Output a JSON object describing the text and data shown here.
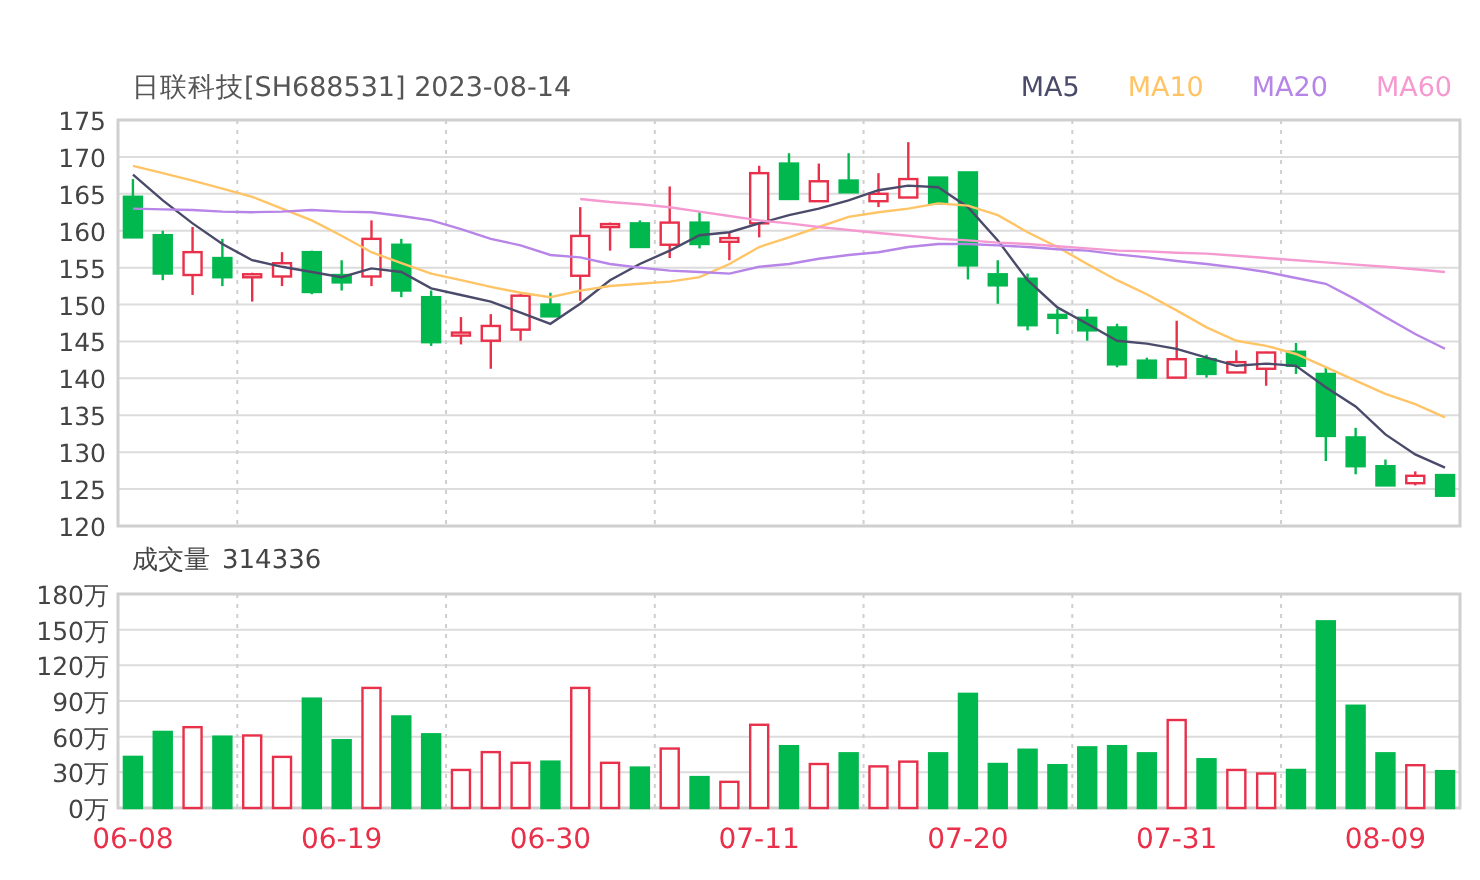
{
  "title": "日联科技[SH688531] 2023-08-14",
  "price_chart": {
    "chart_data": {
      "type": "candlestick",
      "grid": true,
      "ylim": [
        120,
        175
      ],
      "yticks": [
        120,
        125,
        130,
        135,
        140,
        145,
        150,
        155,
        160,
        165,
        170,
        175
      ],
      "categories": [
        null,
        null,
        null,
        null,
        null,
        null,
        null,
        null,
        null,
        null,
        null,
        null,
        null,
        null,
        null,
        null,
        null,
        null,
        null,
        null,
        null,
        null,
        null,
        null,
        null,
        null,
        null,
        null,
        null,
        null,
        null,
        null,
        null,
        null,
        null,
        null,
        null,
        null,
        null,
        null,
        null,
        null,
        null,
        null,
        null
      ],
      "ohlc": [
        [
          164.6,
          167,
          159,
          159.1
        ],
        [
          159.4,
          160,
          153.3,
          154.2
        ],
        [
          154,
          160.5,
          151.3,
          157.1
        ],
        [
          156.3,
          158.9,
          152.5,
          153.7
        ],
        [
          153.8,
          154.3,
          150.4,
          154.1
        ],
        [
          153.8,
          157.1,
          152.5,
          155.6
        ],
        [
          157.1,
          157.3,
          151.4,
          151.7
        ],
        [
          154,
          156,
          151.9,
          153
        ],
        [
          153.8,
          161.4,
          152.5,
          158.9
        ],
        [
          158.1,
          158.9,
          151,
          151.9
        ],
        [
          151,
          151.9,
          144.4,
          144.9
        ],
        [
          145.9,
          148.3,
          144.6,
          146.2
        ],
        [
          145.1,
          148.7,
          141.3,
          147.1
        ],
        [
          146.6,
          151.4,
          145.1,
          151.2
        ],
        [
          150,
          151.6,
          148.3,
          148.4
        ],
        [
          153.9,
          163.2,
          150.5,
          159.3
        ],
        [
          160.5,
          161.1,
          157.3,
          160.9
        ],
        [
          161,
          161.4,
          157.8,
          157.8
        ],
        [
          158.1,
          166,
          156.3,
          161.1
        ],
        [
          161.1,
          162.5,
          157.6,
          158.2
        ],
        [
          158.5,
          159.8,
          156,
          159
        ],
        [
          161,
          168.8,
          159.1,
          167.8
        ],
        [
          169.1,
          170.5,
          164.3,
          164.3
        ],
        [
          164,
          169.1,
          164,
          166.7
        ],
        [
          166.8,
          170.5,
          165.2,
          165.2
        ],
        [
          164,
          167.8,
          163.2,
          165
        ],
        [
          164.5,
          172,
          164.5,
          167
        ],
        [
          167.2,
          167.2,
          163.7,
          163.7
        ],
        [
          167.9,
          167.9,
          153.4,
          155.3
        ],
        [
          154.1,
          156,
          150.1,
          152.6
        ],
        [
          153.5,
          154.2,
          146.5,
          147.2
        ],
        [
          148.6,
          149.4,
          146,
          148.3
        ],
        [
          148.2,
          149.4,
          145.1,
          146.5
        ],
        [
          146.9,
          147.4,
          141.5,
          141.9
        ],
        [
          142.4,
          142.8,
          140.1,
          140.1
        ],
        [
          140.1,
          147.8,
          140.1,
          142.6
        ],
        [
          142.6,
          143.2,
          140.1,
          140.6
        ],
        [
          140.8,
          143.8,
          140.8,
          142.2
        ],
        [
          141.3,
          143.6,
          139,
          143.5
        ],
        [
          143.6,
          144.8,
          140.6,
          141.7
        ],
        [
          140.6,
          141.5,
          128.8,
          132.2
        ],
        [
          132,
          133.3,
          127,
          128.1
        ],
        [
          128.1,
          129,
          125.5,
          125.5
        ],
        [
          125.8,
          127.4,
          125.5,
          126.8
        ],
        [
          126.9,
          126.9,
          124.1,
          124.1
        ]
      ],
      "series": [
        {
          "name": "MA5",
          "type": "line",
          "color": "#4a4a6a",
          "values": [
            167.6,
            164.1,
            161,
            158.2,
            156,
            155.1,
            154.4,
            153.7,
            154.9,
            154.4,
            152.2,
            151.3,
            150.4,
            148.9,
            147.4,
            150.1,
            153.3,
            155.5,
            157.3,
            159.4,
            159.8,
            161,
            162.1,
            163,
            164.1,
            165.5,
            166.1,
            165.9,
            163.2,
            158.7,
            153.3,
            149.6,
            147.4,
            145.1,
            144.7,
            144,
            142.8,
            141.7,
            142,
            141.7,
            138.8,
            136.2,
            132.4,
            129.7,
            127.9
          ]
        },
        {
          "name": "MA10",
          "type": "line",
          "color": "#ffc466",
          "values": [
            168.8,
            167.8,
            166.8,
            165.7,
            164.6,
            163,
            161.4,
            159.3,
            157.1,
            155.6,
            154.2,
            153.3,
            152.4,
            151.6,
            151,
            151.9,
            152.5,
            152.8,
            153.1,
            153.7,
            155.5,
            157.8,
            159.1,
            160.5,
            161.9,
            162.5,
            163,
            163.7,
            163.4,
            162.1,
            159.8,
            157.8,
            155.5,
            153.3,
            151.4,
            149.2,
            146.9,
            145.1,
            144.4,
            143.3,
            141.5,
            139.7,
            137.9,
            136.5,
            134.7
          ]
        },
        {
          "name": "MA20",
          "type": "line",
          "color": "#b784e8",
          "values": [
            163,
            162.9,
            162.8,
            162.6,
            162.5,
            162.6,
            162.8,
            162.6,
            162.5,
            162,
            161.4,
            160.2,
            158.9,
            158,
            156.7,
            156.4,
            155.5,
            155,
            154.6,
            154.4,
            154.2,
            155.1,
            155.5,
            156.2,
            156.7,
            157.1,
            157.8,
            158.2,
            158.2,
            158,
            157.8,
            157.5,
            157.3,
            156.8,
            156.4,
            155.9,
            155.5,
            155,
            154.4,
            153.6,
            152.8,
            150.7,
            148.3,
            146,
            144
          ]
        },
        {
          "name": "MA60",
          "type": "line",
          "color": "#f59ad0",
          "values": [
            null,
            null,
            null,
            null,
            null,
            null,
            null,
            null,
            null,
            null,
            null,
            null,
            null,
            null,
            null,
            164.3,
            163.9,
            163.6,
            163.2,
            162.6,
            162,
            161.4,
            161,
            160.5,
            160.1,
            159.7,
            159.3,
            158.9,
            158.7,
            158.4,
            158.2,
            157.9,
            157.6,
            157.3,
            157.2,
            157,
            156.9,
            156.6,
            156.3,
            156,
            155.7,
            155.4,
            155.1,
            154.8,
            154.4
          ]
        }
      ]
    }
  },
  "volume_panel": {
    "label": "成交量",
    "value": "314336",
    "chart_data": {
      "type": "bar",
      "grid": true,
      "ylim": [
        0,
        180
      ],
      "categories": [
        "06-08",
        null,
        null,
        null,
        null,
        null,
        null,
        "06-19",
        null,
        null,
        null,
        null,
        null,
        null,
        "06-30",
        null,
        null,
        null,
        null,
        null,
        null,
        "07-11",
        null,
        null,
        null,
        null,
        null,
        null,
        "07-20",
        null,
        null,
        null,
        null,
        null,
        null,
        "07-31",
        null,
        null,
        null,
        null,
        null,
        null,
        "08-09",
        null,
        null
      ],
      "yticks": [
        {
          "value": 0,
          "label": "0万"
        },
        {
          "value": 30,
          "label": "30万"
        },
        {
          "value": 60,
          "label": "60万"
        },
        {
          "value": 90,
          "label": "90万"
        },
        {
          "value": 120,
          "label": "120万"
        },
        {
          "value": 150,
          "label": "150万"
        },
        {
          "value": 180,
          "label": "180万"
        }
      ],
      "values": [
        43,
        64,
        68,
        60,
        61,
        43,
        92,
        57,
        101,
        77,
        62,
        32,
        47,
        38,
        39,
        101,
        38,
        34,
        50,
        26,
        22,
        70,
        52,
        37,
        46,
        35,
        39,
        46,
        96,
        37,
        49,
        36,
        51,
        52,
        46,
        74,
        41,
        32,
        29,
        32,
        157,
        86,
        46,
        36,
        31
      ]
    }
  }
}
